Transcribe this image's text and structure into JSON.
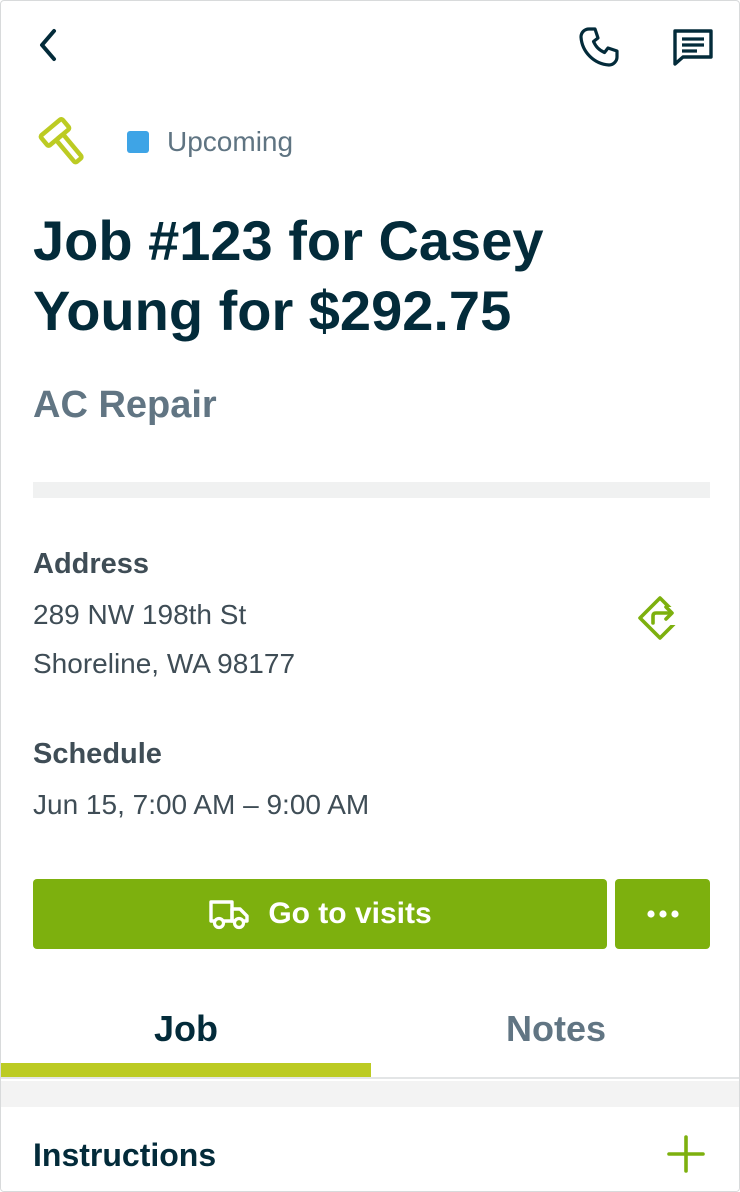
{
  "status": {
    "label": "Upcoming",
    "color": "#3ea4e6"
  },
  "job": {
    "title": "Job #123 for Casey Young for $292.75",
    "service": "AC Repair"
  },
  "address": {
    "label": "Address",
    "line1": "289 NW 198th St",
    "line2": "Shoreline, WA 98177"
  },
  "schedule": {
    "label": "Schedule",
    "value": "Jun 15, 7:00 AM – 9:00 AM"
  },
  "actions": {
    "primary_label": "Go to visits",
    "primary_color": "#7db00e"
  },
  "tabs": [
    {
      "label": "Job",
      "active": true
    },
    {
      "label": "Notes",
      "active": false
    }
  ],
  "instructions": {
    "label": "Instructions"
  },
  "icons": {
    "back": "chevron-left-icon",
    "phone": "phone-icon",
    "message": "message-icon",
    "job_type": "hammer-icon",
    "directions": "directions-icon",
    "truck": "truck-icon",
    "more": "more-horizontal-icon",
    "add": "plus-icon"
  },
  "colors": {
    "accent": "#7db00e",
    "tab_indicator": "#bccb23",
    "text_primary": "#032b3a",
    "text_secondary": "#617583"
  }
}
